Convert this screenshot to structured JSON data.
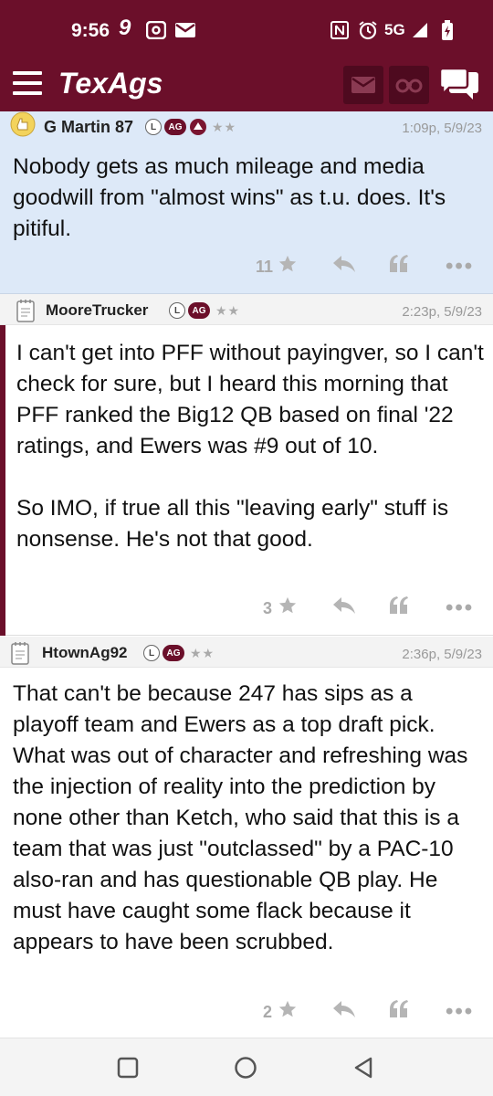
{
  "status_bar": {
    "time": "9:56",
    "network": "5G"
  },
  "header": {
    "logo": "TexAgs"
  },
  "posts": [
    {
      "username": "G Martin 87",
      "badge_l": "L",
      "badge_ag": "AG",
      "stars": "★★",
      "timestamp": "1:09p, 5/9/23",
      "body": "Nobody gets as much mileage and media goodwill from \"almost wins\" as t.u. does. It's pitiful.",
      "star_count": "11",
      "highlighted": true
    },
    {
      "username": "MooreTrucker",
      "badge_l": "L",
      "badge_ag": "AG",
      "stars": "★★",
      "timestamp": "2:23p, 5/9/23",
      "body": "I can't get into PFF without payingver, so I can't check for sure, but I heard this morning that PFF ranked the Big12 QB based on final '22 ratings, and Ewers was #9 out of 10.\n\nSo IMO, if true all this \"leaving early\" stuff is nonsense. He's not that good.",
      "star_count": "3",
      "highlighted": false
    },
    {
      "username": "HtownAg92",
      "badge_l": "L",
      "badge_ag": "AG",
      "stars": "★★",
      "timestamp": "2:36p, 5/9/23",
      "body": "That can't be because 247 has sips as a playoff team and Ewers as a top draft pick. What was out of character and refreshing was the injection of reality into the prediction by none other than Ketch, who said that this is a team that was just \"outclassed\" by a PAC-10 also-ran and has questionable QB play. He must have caught some flack because it appears to have been scrubbed.",
      "star_count": "2",
      "highlighted": false
    }
  ],
  "colors": {
    "brand": "#6b0f2a",
    "highlight_bg": "#dde9f8"
  },
  "icons": {
    "star": "star-icon",
    "reply": "reply-icon",
    "quote": "quote-icon",
    "more": "more-icon"
  }
}
